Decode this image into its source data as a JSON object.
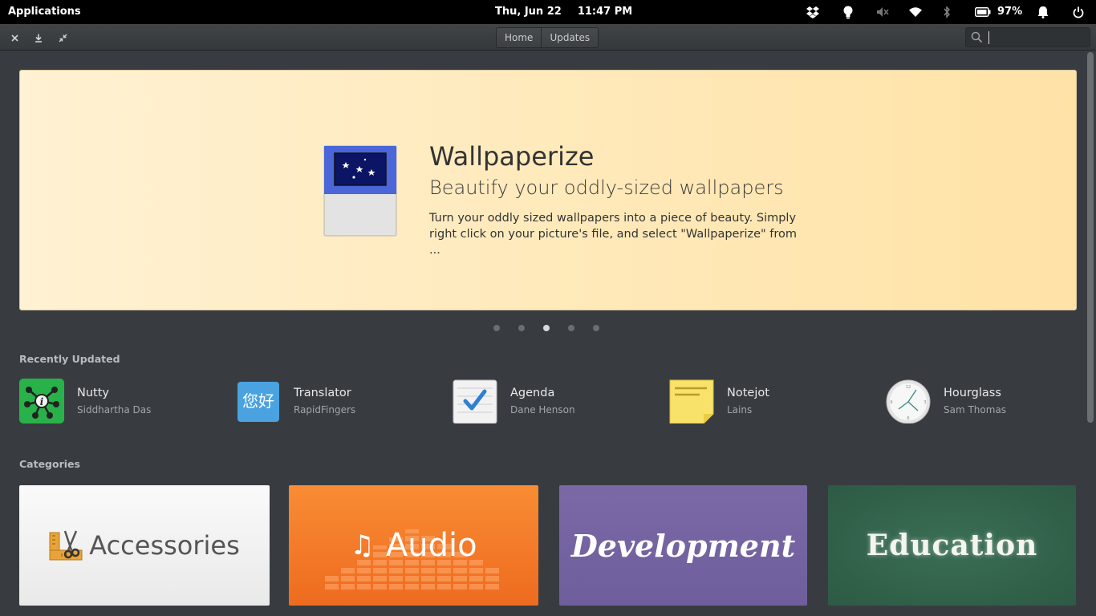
{
  "panel": {
    "applications": "Applications",
    "date": "Thu, Jun 22",
    "time": "11:47 PM",
    "battery_pct": "97%",
    "indicators": [
      "dropbox-icon",
      "lightbulb-icon",
      "volume-muted-icon",
      "wifi-icon",
      "bluetooth-icon",
      "battery-icon",
      "notification-bell-icon",
      "power-icon"
    ]
  },
  "headerbar": {
    "tabs": [
      "Home",
      "Updates"
    ],
    "search_value": ""
  },
  "banner": {
    "title": "Wallpaperize",
    "subtitle": "Beautify your oddly-sized wallpapers",
    "description": "Turn your oddly sized wallpapers into a piece of beauty. Simply right click on your picture's file, and select \"Wallpaperize\" from ...",
    "page_count": 5,
    "active_page": 3,
    "background": "#ffe9b9"
  },
  "recently_updated": {
    "title": "Recently Updated",
    "items": [
      {
        "name": "Nutty",
        "author": "Siddhartha Das"
      },
      {
        "name": "Translator",
        "author": "RapidFingers"
      },
      {
        "name": "Agenda",
        "author": "Dane Henson"
      },
      {
        "name": "Notejot",
        "author": "Lains"
      },
      {
        "name": "Hourglass",
        "author": "Sam Thomas"
      }
    ]
  },
  "categories": {
    "title": "Categories",
    "items": [
      {
        "label": "Accessories",
        "color": "#f4f4f4"
      },
      {
        "label": "Audio",
        "color": "#f47a2a"
      },
      {
        "label": "Development",
        "color": "#7565a1"
      },
      {
        "label": "Education",
        "color": "#336349"
      }
    ]
  },
  "translator_glyph": "您好"
}
